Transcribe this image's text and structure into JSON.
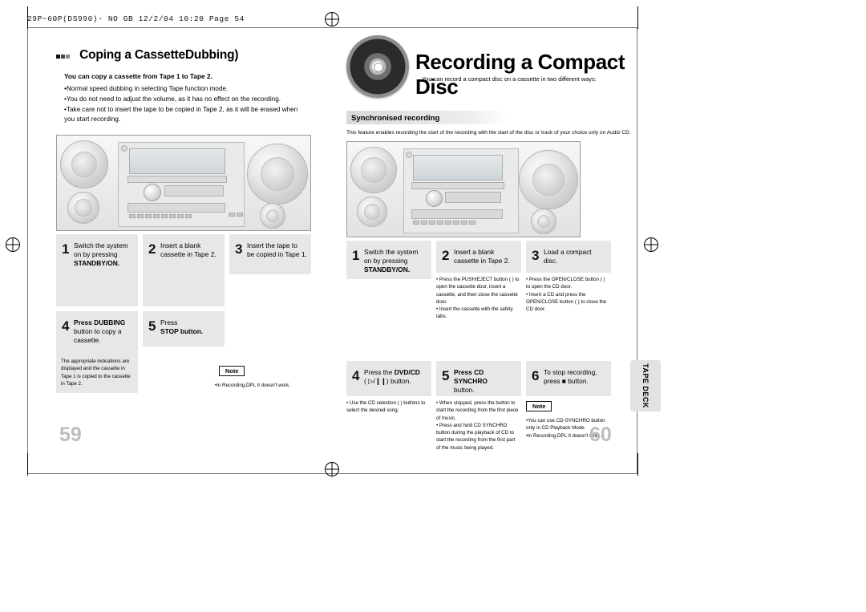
{
  "print_header": "29P~60P(DS990)- NO GB  12/2/04 10:20  Page 54",
  "left": {
    "title": "Coping a CassetteDubbing)",
    "lead": "You can copy a cassette from Tape 1 to Tape 2.",
    "bullets": [
      "•Normal speed dubbing in selecting Tape function mode.",
      "•You do not need to adjust the volume, as it has no effect on the recording.",
      "•Take care not to insert the tape to be copied in Tape 2, as it will be erased when",
      "you start recording."
    ],
    "steps": [
      {
        "num": "1",
        "lines": [
          "Switch the system",
          "on by pressing",
          "STANDBY/ON."
        ]
      },
      {
        "num": "2",
        "lines": [
          "Insert a blank",
          "cassette in Tape 2."
        ]
      },
      {
        "num": "3",
        "lines": [
          "Insert the tape to",
          "be copied in Tape 1."
        ]
      },
      {
        "num": "4",
        "lines": [
          "Press DUBBING",
          "button to copy a",
          "cassette."
        ]
      },
      {
        "num": "5",
        "lines": [
          "Press",
          "STOP button."
        ]
      }
    ],
    "note_4": "The appropriate indications are displayed and the cassette in Tape 1 is copied to the cassette in Tape 2.",
    "note_label": "Note",
    "note_5": "•In Recording,DPL II doesn't work.",
    "page_number": "59"
  },
  "right": {
    "title": "Recording a Compact Disc",
    "subcaption": "You can record a compact disc on a cassette in two different ways:",
    "section": "Synchronised recording",
    "section_desc": "This feature enables recording the start of the recording with the start of the disc or track of your choice only on Audio CD.",
    "steps": [
      {
        "num": "1",
        "lines": [
          "Switch the system",
          "on by pressing",
          "STANDBY/ON."
        ]
      },
      {
        "num": "2",
        "lines": [
          "Insert a blank",
          "cassette in Tape 2."
        ]
      },
      {
        "num": "3",
        "lines": [
          "Load a compact",
          "disc."
        ]
      },
      {
        "num": "4",
        "lines": [
          "Press the DVD/CD",
          "(      ) button."
        ]
      },
      {
        "num": "5",
        "lines": [
          "Press CD SYNCHRO",
          "button."
        ]
      },
      {
        "num": "6",
        "lines": [
          "To stop recording,",
          "press      button."
        ]
      }
    ],
    "note_2": "• Press the PUSH/EJECT button (    ) to open the cassette door, insert a cassette, and then close the cassette door.\n• Insert the cassette with the safety tabs.",
    "note_3": "• Press the OPEN/CLOSE button (    ) to open the CD door.\n• Insert a CD and press the OPEN/CLOSE button (    ) to close the CD door.",
    "note_4": "• Use the CD selection (         ) buttons to select the desired song.",
    "note_5": "• When stopped, press the button to start the recording from the first piece of music.\n• Press and hold  CD  SYNCHRO  button during the playback of CD to start the recording from the first part of the music being played.",
    "note_label": "Note",
    "note_6": "•You can use CD-SYNCHRO button only in CD Playback Mode.\n•In Recording,DPL II doesn't work.",
    "side_tab": "TAPE DECK",
    "page_number": "60"
  }
}
